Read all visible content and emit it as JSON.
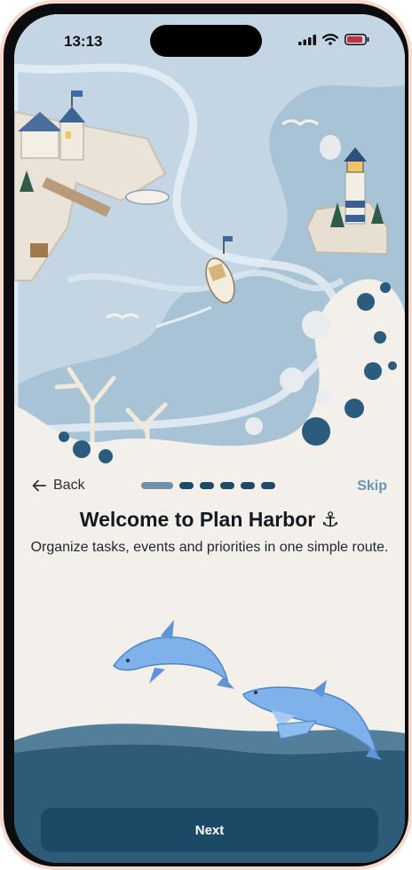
{
  "status_bar": {
    "time": "13:13"
  },
  "nav": {
    "back_label": "Back",
    "skip_label": "Skip",
    "steps_total": 6,
    "step_current": 1
  },
  "content": {
    "title": "Welcome to Plan Harbor ⚓",
    "subtitle": "Organize tasks, events and priorities in one simple route."
  },
  "primary_button": {
    "label": "Next"
  },
  "colors": {
    "accent": "#1c4965",
    "skip": "#6a94b4",
    "background": "#f3efea",
    "water": "#a9c3d6"
  }
}
